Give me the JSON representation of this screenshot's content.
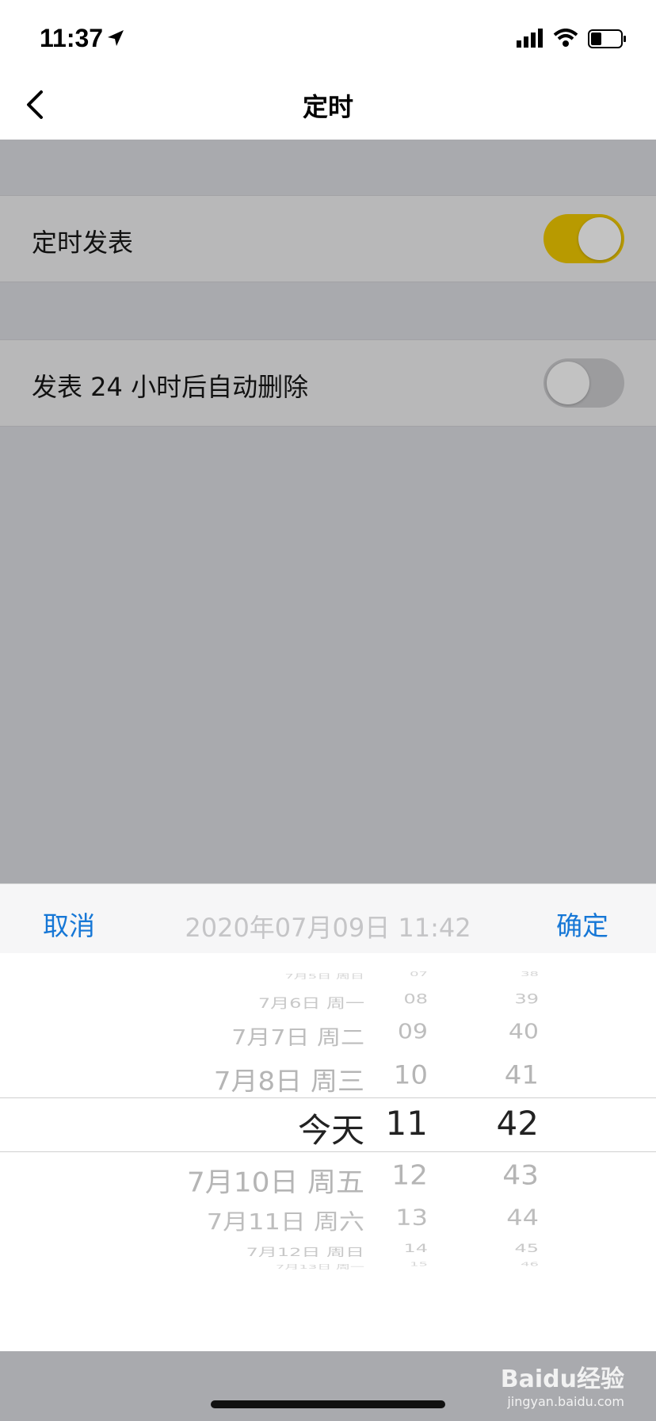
{
  "status_bar": {
    "time": "11:37"
  },
  "nav": {
    "title": "定时"
  },
  "settings": {
    "row1": {
      "label": "定时发表",
      "enabled": true
    },
    "row2": {
      "label": "发表 24 小时后自动删除",
      "enabled": false
    }
  },
  "picker": {
    "cancel_label": "取消",
    "confirm_label": "确定",
    "preview": "2020年07月09日 11:42",
    "date_items": [
      "7月5日 周日",
      "7月6日 周一",
      "7月7日 周二",
      "7月8日 周三",
      "今天",
      "7月10日 周五",
      "7月11日 周六",
      "7月12日 周日",
      "7月13日 周一"
    ],
    "hour_items": [
      "07",
      "08",
      "09",
      "10",
      "11",
      "12",
      "13",
      "14",
      "15"
    ],
    "minute_items": [
      "38",
      "39",
      "40",
      "41",
      "42",
      "43",
      "44",
      "45",
      "46"
    ],
    "selected_index": 4
  },
  "watermark": {
    "text": "Baidu经验",
    "subtext": "jingyan.baidu.com"
  },
  "colors": {
    "accent": "#1677d6",
    "toggle_on": "#b89a00",
    "overlay": "#a9aaae"
  }
}
